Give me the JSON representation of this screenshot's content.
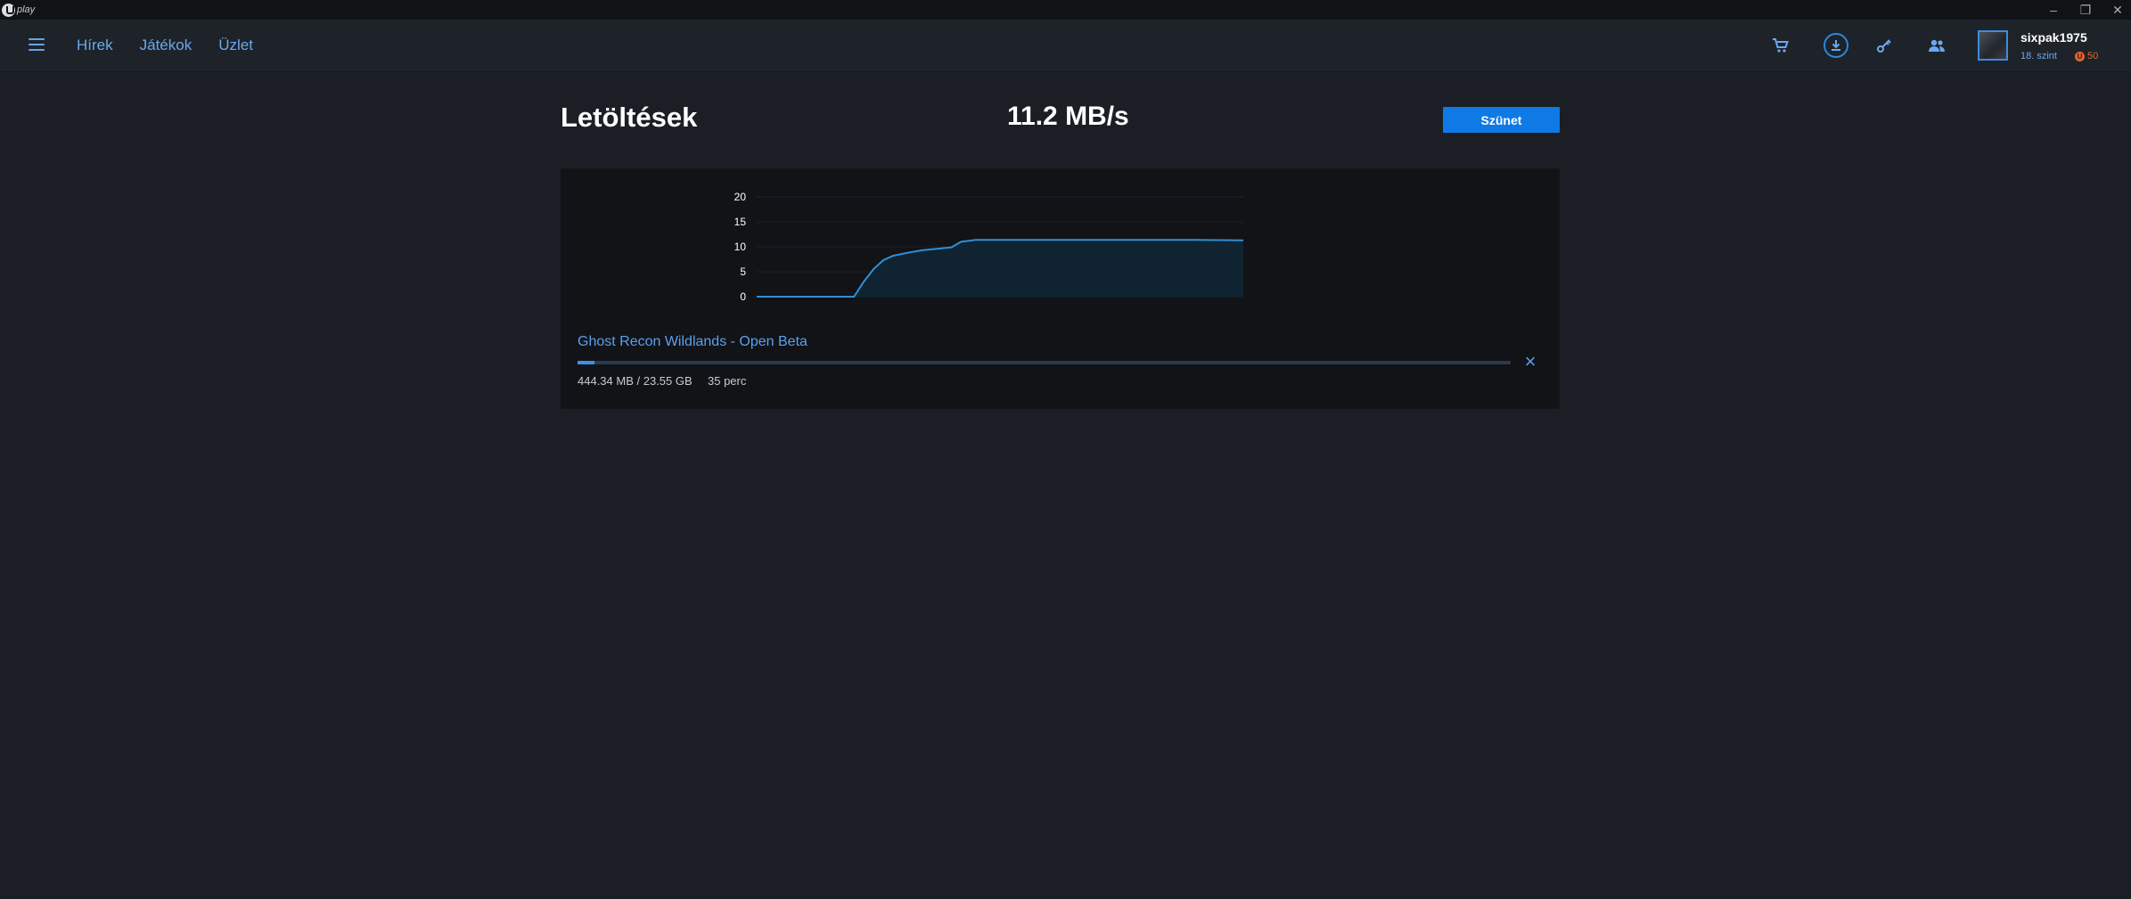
{
  "titlebar": {
    "logo_text": "play",
    "controls": [
      "minimize-icon",
      "restore-icon",
      "close-icon"
    ]
  },
  "header": {
    "nav": [
      "Hírek",
      "Játékok",
      "Üzlet"
    ],
    "icons": [
      "cart-icon",
      "download-icon",
      "key-icon",
      "friends-icon"
    ],
    "user": {
      "name": "sixpak1975",
      "level": "18. szint",
      "units": "50"
    },
    "colors": {
      "accent": "#6aa8ef",
      "units": "#e8622c"
    }
  },
  "downloads": {
    "title": "Letöltések",
    "speed": "11.2 MB/s",
    "pause_label": "Szünet",
    "item": {
      "name": "Ghost Recon Wildlands - Open Beta",
      "size": "444.34 MB / 23.55 GB",
      "time_left": "35 perc",
      "progress": 0.0184
    }
  },
  "chart_data": {
    "type": "area",
    "ylim": [
      0,
      20
    ],
    "yticks": [
      0,
      5,
      10,
      15,
      20
    ],
    "x": [
      0,
      5,
      10,
      15,
      17,
      20,
      22,
      24,
      26,
      28,
      31,
      34,
      37,
      40,
      42,
      45,
      50,
      60,
      70,
      80,
      90,
      100
    ],
    "y": [
      0,
      0,
      0,
      0,
      0,
      0,
      3,
      5.5,
      7.3,
      8.2,
      8.8,
      9.3,
      9.6,
      9.9,
      11.0,
      11.4,
      11.4,
      11.4,
      11.4,
      11.4,
      11.4,
      11.3
    ],
    "grid": true,
    "colors": {
      "line": "#2f8fd6",
      "fill": "#0f2430",
      "grid": "#1d2128"
    }
  }
}
